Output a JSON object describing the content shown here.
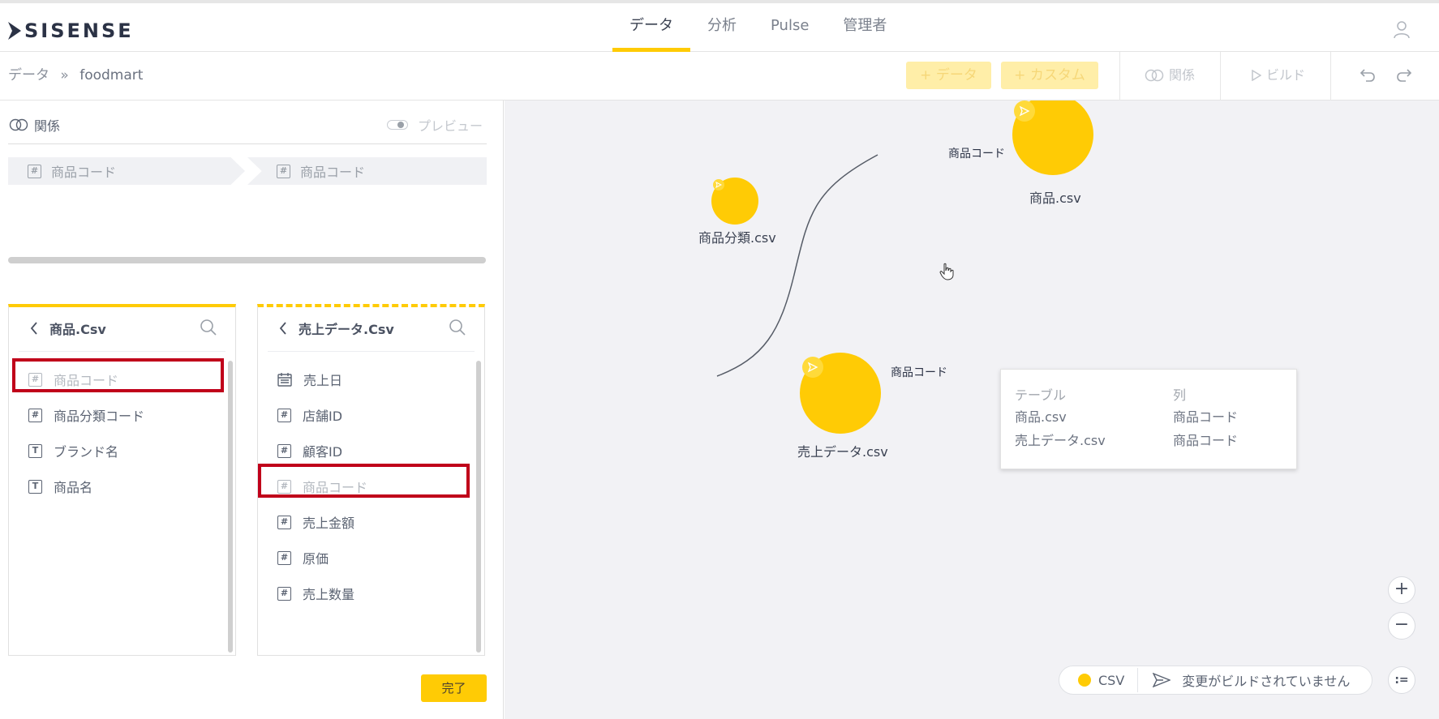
{
  "app": {
    "logo_text": "SISENSE",
    "nav": [
      {
        "label": "データ",
        "active": true
      },
      {
        "label": "分析",
        "active": false
      },
      {
        "label": "Pulse",
        "active": false
      },
      {
        "label": "管理者",
        "active": false
      }
    ],
    "user_icon": "user-icon"
  },
  "toolbar": {
    "breadcrumb_root": "データ",
    "breadcrumb_sep": "»",
    "breadcrumb_current": "foodmart",
    "add_data": "+ データ",
    "add_custom": "+ カスタム",
    "relations": "関係",
    "build": "ビルド",
    "undo_icon": "undo-icon",
    "redo_icon": "redo-icon"
  },
  "relation_panel": {
    "title": "関係",
    "preview_label": "プレビュー",
    "left_field": "商品コード",
    "right_field": "商品コード",
    "done": "完了"
  },
  "tables": {
    "left": {
      "title": "商品.Csv",
      "fields": [
        {
          "name": "商品コード",
          "type": "#"
        },
        {
          "name": "商品分類コード",
          "type": "#"
        },
        {
          "name": "ブランド名",
          "type": "T"
        },
        {
          "name": "商品名",
          "type": "T"
        }
      ]
    },
    "right": {
      "title": "売上データ.Csv",
      "fields": [
        {
          "name": "売上日",
          "type": "date"
        },
        {
          "name": "店舗ID",
          "type": "#"
        },
        {
          "name": "顧客ID",
          "type": "#"
        },
        {
          "name": "商品コード",
          "type": "#"
        },
        {
          "name": "売上金額",
          "type": "#"
        },
        {
          "name": "原価",
          "type": "#"
        },
        {
          "name": "売上数量",
          "type": "#"
        }
      ]
    }
  },
  "canvas": {
    "nodes": [
      {
        "label": "商品分類.csv"
      },
      {
        "label": "商品.csv"
      },
      {
        "label": "売上データ.csv"
      }
    ],
    "edge_labels": [
      "商品コード",
      "商品コード"
    ],
    "tooltip": {
      "col_table": "テーブル",
      "col_column": "列",
      "rows": [
        {
          "table": "商品.csv",
          "column": "商品コード"
        },
        {
          "table": "売上データ.csv",
          "column": "商品コード"
        }
      ]
    },
    "zoom_in": "+",
    "zoom_out": "−",
    "status": {
      "legend": "CSV",
      "message": "変更がビルドされていません",
      "color": "#ffcb05"
    },
    "legend_toggle": ":="
  },
  "colors": {
    "accent": "#ffcb05",
    "highlight": "#c0001a"
  }
}
